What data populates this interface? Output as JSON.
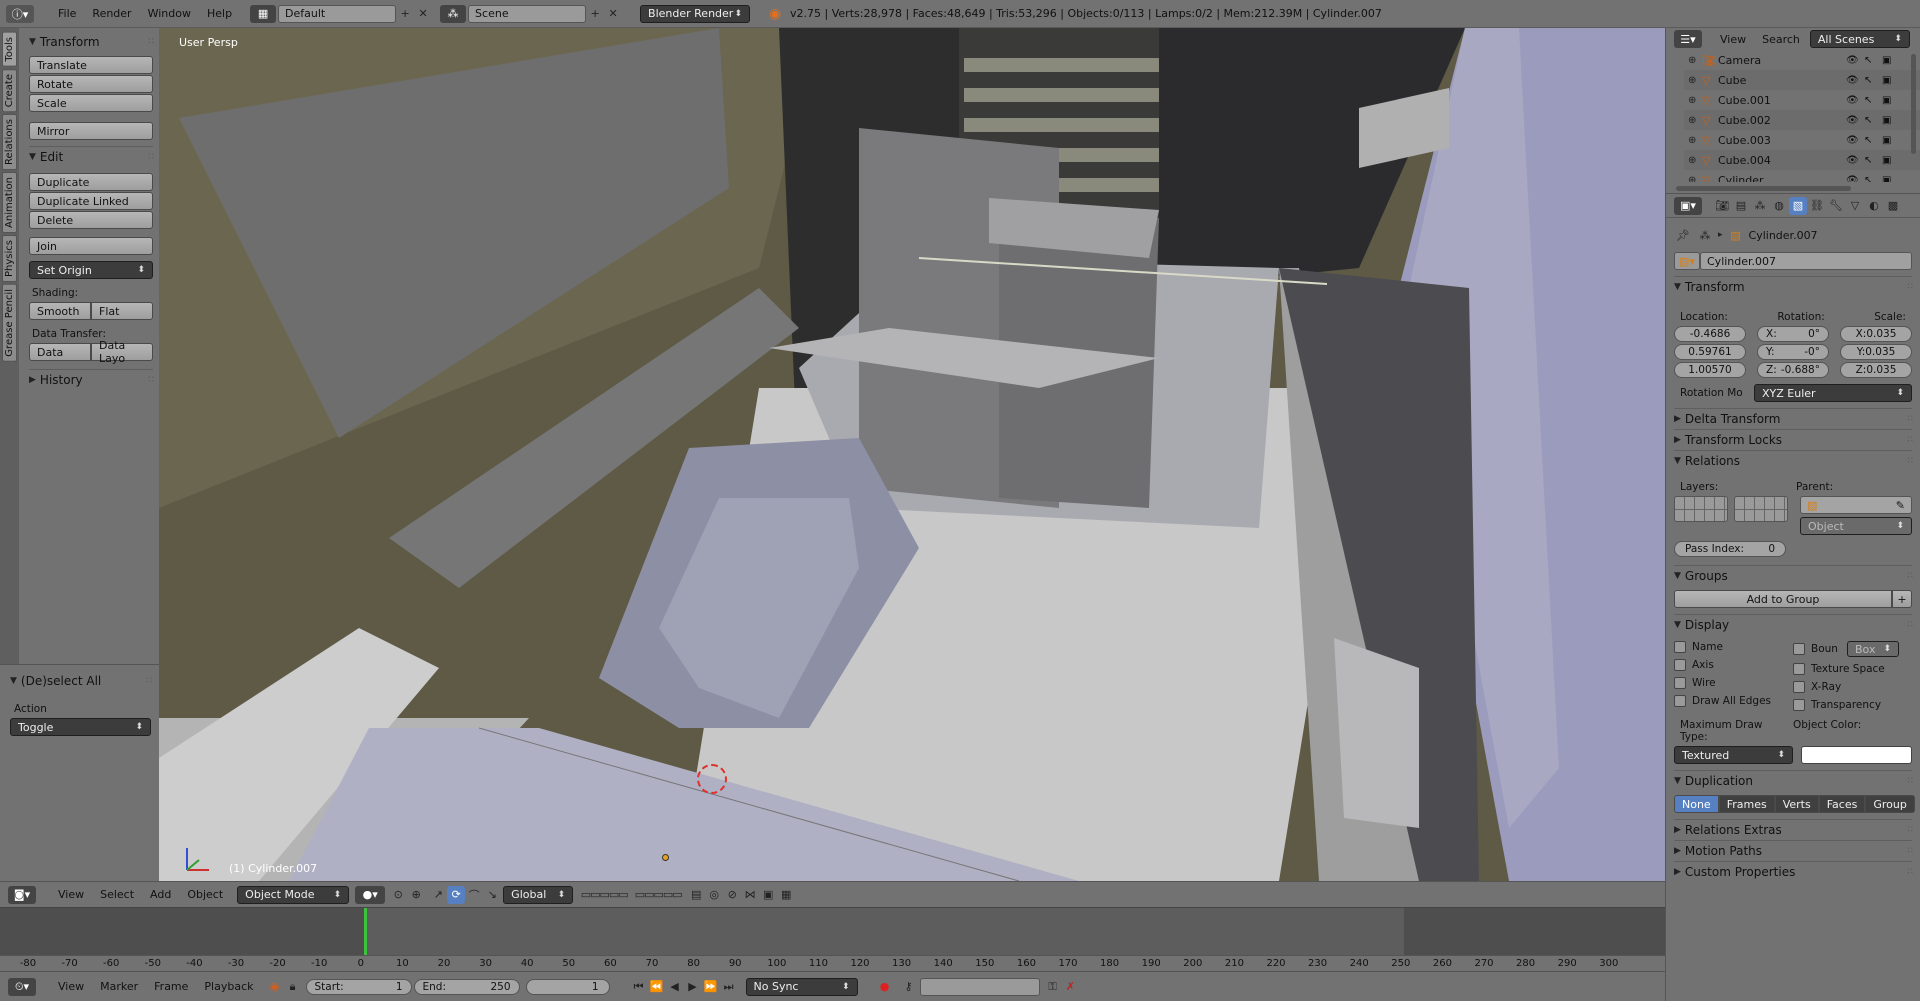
{
  "topbar": {
    "menus": [
      "File",
      "Render",
      "Window",
      "Help"
    ],
    "screen_layout": "Default",
    "scene": "Scene",
    "render_engine": "Blender Render",
    "stats": "v2.75 | Verts:28,978 | Faces:48,649 | Tris:53,296 | Objects:0/113 | Lamps:0/2 | Mem:212.39M | Cylinder.007"
  },
  "tool_tabs": [
    "Tools",
    "Create",
    "Relations",
    "Animation",
    "Physics",
    "Grease Pencil"
  ],
  "tool_shelf": {
    "transform_title": "Transform",
    "translate": "Translate",
    "rotate": "Rotate",
    "scale": "Scale",
    "mirror": "Mirror",
    "edit_title": "Edit",
    "duplicate": "Duplicate",
    "duplicate_linked": "Duplicate Linked",
    "delete": "Delete",
    "join": "Join",
    "set_origin": "Set Origin",
    "shading_label": "Shading:",
    "smooth": "Smooth",
    "flat": "Flat",
    "data_transfer_label": "Data Transfer:",
    "data": "Data",
    "data_layout": "Data Layo",
    "history_title": "History"
  },
  "operator_panel": {
    "title": "(De)select All",
    "action_label": "Action",
    "action_value": "Toggle"
  },
  "viewport": {
    "view_name": "User Persp",
    "object_label": "(1) Cylinder.007"
  },
  "view3d_header": {
    "menus": [
      "View",
      "Select",
      "Add",
      "Object"
    ],
    "mode": "Object Mode",
    "orientation": "Global"
  },
  "outliner": {
    "menus": [
      "View",
      "Search"
    ],
    "filter": "All Scenes",
    "items": [
      "Camera",
      "Cube",
      "Cube.001",
      "Cube.002",
      "Cube.003",
      "Cube.004",
      "Cylinder"
    ]
  },
  "properties": {
    "breadcrumb": "Cylinder.007",
    "object_name": "Cylinder.007",
    "transform_title": "Transform",
    "location_label": "Location:",
    "rotation_label": "Rotation:",
    "scale_label": "Scale:",
    "location": [
      "-0.4686",
      "0.59761",
      "1.00570"
    ],
    "rotation": [
      "X:",
      "0°",
      "Y:",
      "-0°",
      "Z:",
      "-0.688°"
    ],
    "scale": [
      "X:0.035",
      "Y:0.035",
      "Z:0.035"
    ],
    "rotation_mode_label": "Rotation Mo",
    "rotation_mode": "XYZ Euler",
    "delta_transform": "Delta Transform",
    "transform_locks": "Transform Locks",
    "relations_title": "Relations",
    "layers_label": "Layers:",
    "parent_label": "Parent:",
    "parent_type": "Object",
    "pass_index_label": "Pass Index:",
    "pass_index": "0",
    "groups_title": "Groups",
    "add_to_group": "Add to Group",
    "display_title": "Display",
    "display_left": [
      "Name",
      "Axis",
      "Wire",
      "Draw All Edges"
    ],
    "display_right": [
      "Boun",
      "Texture Space",
      "X-Ray",
      "Transparency"
    ],
    "bounds_type": "Box",
    "max_draw_type_label": "Maximum Draw Type:",
    "max_draw_type": "Textured",
    "object_color_label": "Object Color:",
    "duplication_title": "Duplication",
    "duplication_options": [
      "None",
      "Frames",
      "Verts",
      "Faces",
      "Group"
    ],
    "relations_extras": "Relations Extras",
    "motion_paths": "Motion Paths",
    "custom_properties": "Custom Properties"
  },
  "timeline": {
    "ticks": [
      "-80",
      "-70",
      "-60",
      "-50",
      "-40",
      "-30",
      "-20",
      "-10",
      "0",
      "10",
      "20",
      "30",
      "40",
      "50",
      "60",
      "70",
      "80",
      "90",
      "100",
      "110",
      "120",
      "130",
      "140",
      "150",
      "160",
      "170",
      "180",
      "190",
      "200",
      "210",
      "220",
      "230",
      "240",
      "250",
      "260",
      "270",
      "280",
      "290",
      "300"
    ],
    "menus": [
      "View",
      "Marker",
      "Frame",
      "Playback"
    ],
    "start_label": "Start:",
    "start": "1",
    "end_label": "End:",
    "end": "250",
    "current": "1",
    "sync": "No Sync"
  },
  "colors": {
    "ui_bg": "#727272",
    "viewport_wall": "#5e5a45",
    "selected_blue": "#5680c2"
  }
}
